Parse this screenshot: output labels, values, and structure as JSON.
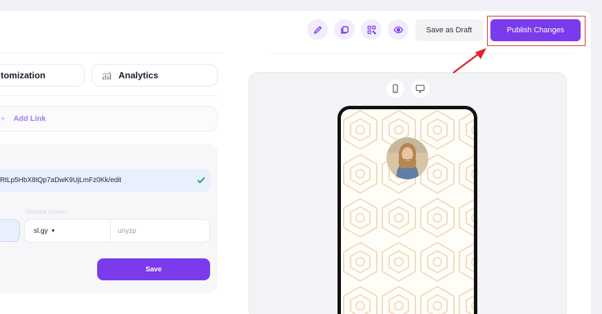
{
  "toolbar": {
    "edit_icon": "pencil-icon",
    "duplicate_icon": "copy-icon",
    "qr_icon": "qr-code-icon",
    "preview_icon": "eye-icon",
    "save_draft_label": "Save as Draft",
    "publish_label": "Publish Changes"
  },
  "tabs": [
    {
      "label": "tomization"
    },
    {
      "label": "Analytics",
      "icon": "analytics-icon"
    }
  ],
  "add_link": {
    "icon": "plus",
    "label": "Add Link"
  },
  "form": {
    "url_value": "RtLp5HbX8tQp7aDwK9UjLmFz0Kk/edit",
    "shortlink_label": "Shortlink Domain",
    "domain_value": "sl.gy",
    "slug_value": "unyzp",
    "save_label": "Save"
  },
  "preview": {
    "mobile_icon": "smartphone-icon",
    "desktop_icon": "monitor-icon"
  },
  "colors": {
    "accent": "#7c3aed",
    "highlight": "#e0262b",
    "check": "#16a34a"
  }
}
